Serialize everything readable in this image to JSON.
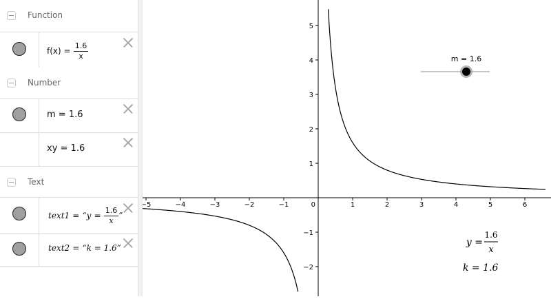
{
  "algebra": {
    "function_group": {
      "title": "Function"
    },
    "function_item": {
      "name": "f(x) =",
      "numerator": "1.6",
      "denominator": "x"
    },
    "number_group": {
      "title": "Number"
    },
    "number_items": [
      {
        "text": "m = 1.6"
      },
      {
        "text": "xy = 1.6"
      }
    ],
    "text_group": {
      "title": "Text"
    },
    "text1": {
      "name": "text1",
      "eq": "=",
      "lq": "“",
      "y": "y",
      "eq2": "=",
      "numerator": "1.6",
      "denominator": "x",
      "rq": "”"
    },
    "text2": {
      "name": "text2",
      "eq": "=",
      "value": "“k = 1.6”"
    }
  },
  "graphics": {
    "x_ticks": [
      "−5",
      "−4",
      "−3",
      "−2",
      "−1",
      "0",
      "1",
      "2",
      "3",
      "4",
      "5",
      "6"
    ],
    "y_ticks": [
      "5",
      "4",
      "3",
      "2",
      "1",
      "−1",
      "−2"
    ],
    "slider": {
      "label": "m = 1.6",
      "value": 1.6,
      "min": -5,
      "max": 5
    },
    "text_y": {
      "lhs": "y =",
      "numerator": "1.6",
      "denominator": "x"
    },
    "text_k": "k = 1.6",
    "function": {
      "k": 1.6
    },
    "x_range": [
      -5.3,
      6.6
    ],
    "y_range": [
      -2.8,
      5.7
    ]
  }
}
